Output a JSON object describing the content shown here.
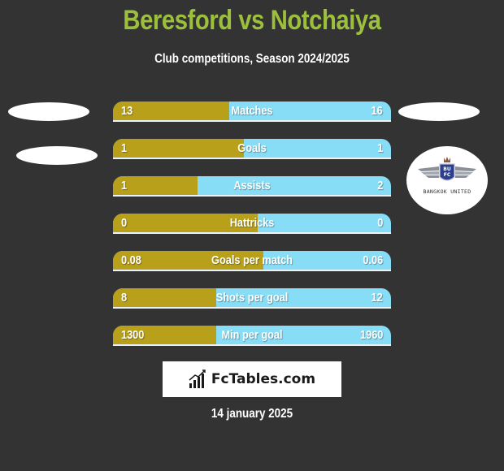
{
  "header": {
    "title": "Beresford vs Notchaiya",
    "subtitle": "Club competitions, Season 2024/2025"
  },
  "teams": {
    "home": {
      "name": "Beresford",
      "logo": "placeholder-oval"
    },
    "away": {
      "name": "Notchaiya",
      "logo": "bangkok-united-crest",
      "logo_text": "BANGKOK UNITED",
      "crest_letters": "BUFC"
    }
  },
  "colors": {
    "title": "#9cbf3c",
    "home_bar": "#b8a01a",
    "away_bar": "#87ddf6",
    "background": "#333333"
  },
  "stats": [
    {
      "label": "Matches",
      "home": "13",
      "away": "16",
      "home_share": 0.418
    },
    {
      "label": "Goals",
      "home": "1",
      "away": "1",
      "home_share": 0.47
    },
    {
      "label": "Assists",
      "home": "1",
      "away": "2",
      "home_share": 0.304
    },
    {
      "label": "Hattricks",
      "home": "0",
      "away": "0",
      "home_share": 0.52
    },
    {
      "label": "Goals per match",
      "home": "0.08",
      "away": "0.06",
      "home_share": 0.54
    },
    {
      "label": "Shots per goal",
      "home": "8",
      "away": "12",
      "home_share": 0.371
    },
    {
      "label": "Min per goal",
      "home": "1300",
      "away": "1960",
      "home_share": 0.371
    }
  ],
  "brand": {
    "name": "FcTables.com",
    "icon": "bar-chart-icon"
  },
  "date": "14 january 2025"
}
